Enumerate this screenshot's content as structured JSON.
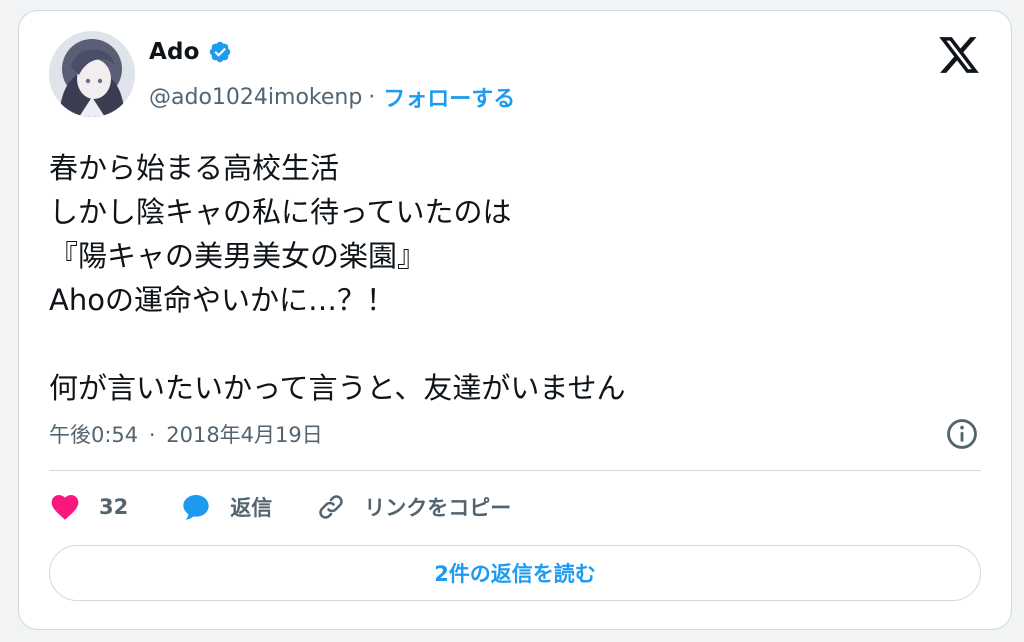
{
  "author": {
    "name": "Ado",
    "handle": "@ado1024imokenp",
    "separator": "·",
    "follow_label": "フォローする"
  },
  "tweet": {
    "text": "春から始まる高校生活\nしかし陰キャの私に待っていたのは\n『陽キャの美男美女の楽園』\nAhoの運命やいかに…？！\n\n何が言いたいかって言うと、友達がいません",
    "time": "午後0:54",
    "separator": "·",
    "date": "2018年4月19日"
  },
  "actions": {
    "like_count": "32",
    "reply_label": "返信",
    "copy_link_label": "リンクをコピー"
  },
  "replies_button_label": "2件の返信を読む",
  "colors": {
    "accent": "#1d9bf0",
    "like": "#f91880",
    "secondary_text": "#536471",
    "border": "#cfd9de"
  },
  "icons": [
    "verified-badge-icon",
    "x-logo-icon",
    "info-icon",
    "heart-icon",
    "reply-bubble-icon",
    "link-icon"
  ]
}
